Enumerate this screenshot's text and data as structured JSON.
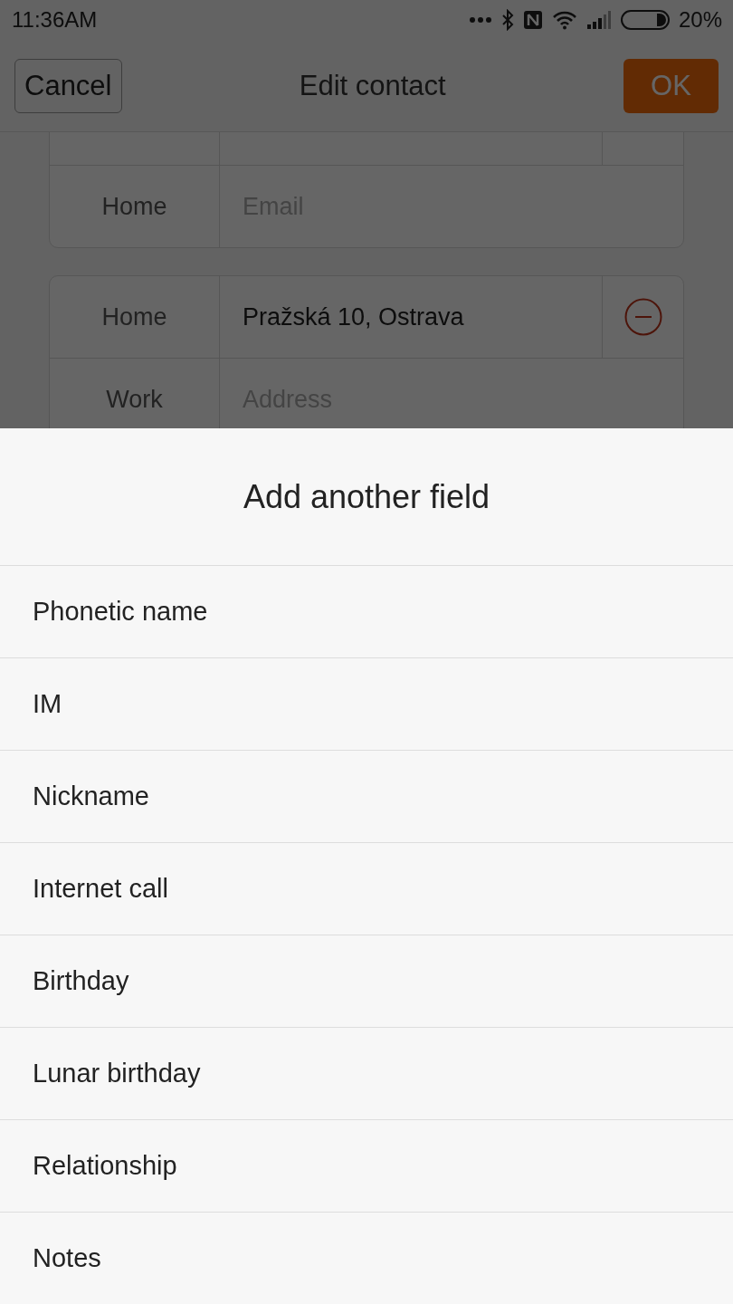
{
  "status_bar": {
    "time": "11:36AM",
    "battery": "20%"
  },
  "header": {
    "cancel": "Cancel",
    "title": "Edit contact",
    "ok": "OK"
  },
  "sections": [
    {
      "rows": [
        {
          "label": "Home",
          "placeholder": "Email",
          "removable": false
        }
      ]
    },
    {
      "rows": [
        {
          "label": "Home",
          "value": "Pražská 10, Ostrava",
          "removable": true
        },
        {
          "label": "Work",
          "placeholder": "Address",
          "removable": false
        }
      ]
    }
  ],
  "sheet": {
    "title": "Add another field",
    "items": [
      "Phonetic name",
      "IM",
      "Nickname",
      "Internet call",
      "Birthday",
      "Lunar birthday",
      "Relationship",
      "Notes"
    ]
  }
}
